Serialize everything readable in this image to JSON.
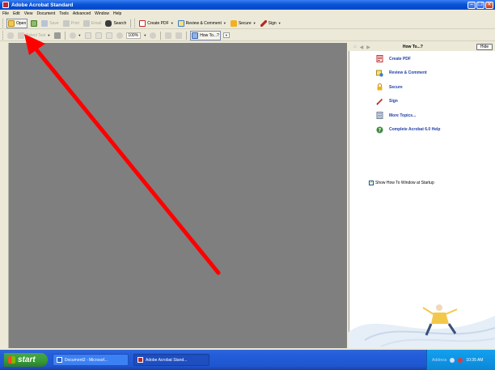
{
  "window": {
    "title": "Adobe Acrobat Standard",
    "min": "–",
    "max": "❐",
    "close": "✕"
  },
  "menu": [
    "File",
    "Edit",
    "View",
    "Document",
    "Tools",
    "Advanced",
    "Window",
    "Help"
  ],
  "toolbar1": {
    "open": "Open",
    "save": "Save",
    "print": "Print",
    "email": "Email",
    "search": "Search",
    "create_pdf": "Create PDF",
    "review": "Review & Comment",
    "secure": "Secure",
    "sign": "Sign"
  },
  "toolbar2": {
    "select_text": "Select Text",
    "zoom": "100%",
    "howto": "How To...?"
  },
  "howto": {
    "title": "How To...?",
    "hide": "Hide",
    "topics": [
      {
        "label": "Create PDF",
        "icon": "create-pdf-icon"
      },
      {
        "label": "Review & Comment",
        "icon": "review-comment-icon"
      },
      {
        "label": "Secure",
        "icon": "lock-icon"
      },
      {
        "label": "Sign",
        "icon": "pen-icon"
      },
      {
        "label": "More Topics...",
        "icon": "document-icon"
      },
      {
        "label": "Complete Acrobat 6.0 Help",
        "icon": "help-icon"
      }
    ],
    "startup": "Show How To Window at Startup",
    "startup_checked": true
  },
  "taskbar": {
    "start": "start",
    "tasks": [
      {
        "label": "Document2 - Microsof...",
        "active": false
      },
      {
        "label": "Adobe Acrobat Stand...",
        "active": true
      }
    ],
    "address": "Address",
    "clock": "10:35 AM"
  },
  "colors": {
    "arrow": "#ff0000",
    "link": "#1f3fa8",
    "doc_bg": "#7f7f7f"
  }
}
